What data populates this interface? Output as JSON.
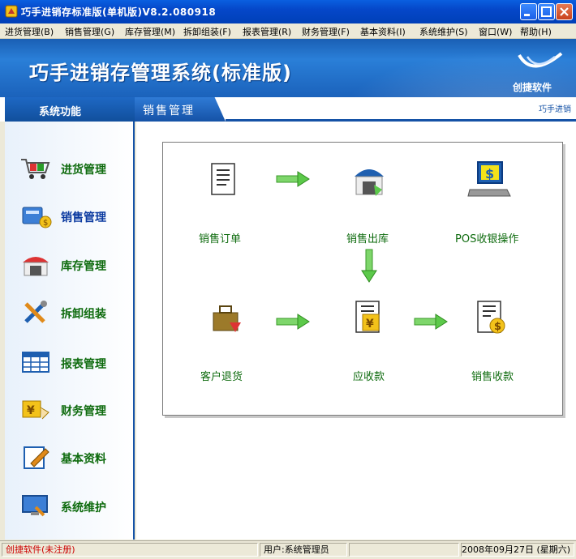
{
  "window": {
    "title": "巧手进销存标准版(单机版)V8.2.080918"
  },
  "menu": [
    {
      "label": "进货管理(B)"
    },
    {
      "label": "销售管理(G)"
    },
    {
      "label": "库存管理(M)"
    },
    {
      "label": "拆卸组装(F)"
    },
    {
      "label": "报表管理(R)"
    },
    {
      "label": "财务管理(F)"
    },
    {
      "label": "基本资料(I)"
    },
    {
      "label": "系统维护(S)"
    },
    {
      "label": "窗口(W)"
    },
    {
      "label": "帮助(H)"
    }
  ],
  "banner": {
    "title": "巧手进销存管理系统(标准版)",
    "logo_text": "创捷软件"
  },
  "header": {
    "left_title": "系统功能",
    "section_title": "销售管理",
    "marquee": "巧手进销"
  },
  "nav": [
    {
      "label": "进货管理",
      "icon": "cart-icon"
    },
    {
      "label": "销售管理",
      "icon": "sales-icon"
    },
    {
      "label": "库存管理",
      "icon": "warehouse-icon"
    },
    {
      "label": "拆卸组装",
      "icon": "tools-icon"
    },
    {
      "label": "报表管理",
      "icon": "table-icon"
    },
    {
      "label": "财务管理",
      "icon": "finance-icon"
    },
    {
      "label": "基本资料",
      "icon": "edit-icon"
    },
    {
      "label": "系统维护",
      "icon": "monitor-icon"
    }
  ],
  "flow": {
    "sales_order": "销售订单",
    "sales_outbound": "销售出库",
    "pos": "POS收银操作",
    "customer_return": "客户退货",
    "receivable": "应收款",
    "sales_collection": "销售收款"
  },
  "status": {
    "registration": "创捷软件(未注册)",
    "user": "用户:系统管理员",
    "date": "2008年09月27日 (星期六)"
  },
  "colors": {
    "title_blue": "#0547c9",
    "banner_blue": "#1a5fb4",
    "label_green": "#0e6b0e",
    "active_blue": "#0b3aa0",
    "status_red": "#cc0000"
  }
}
